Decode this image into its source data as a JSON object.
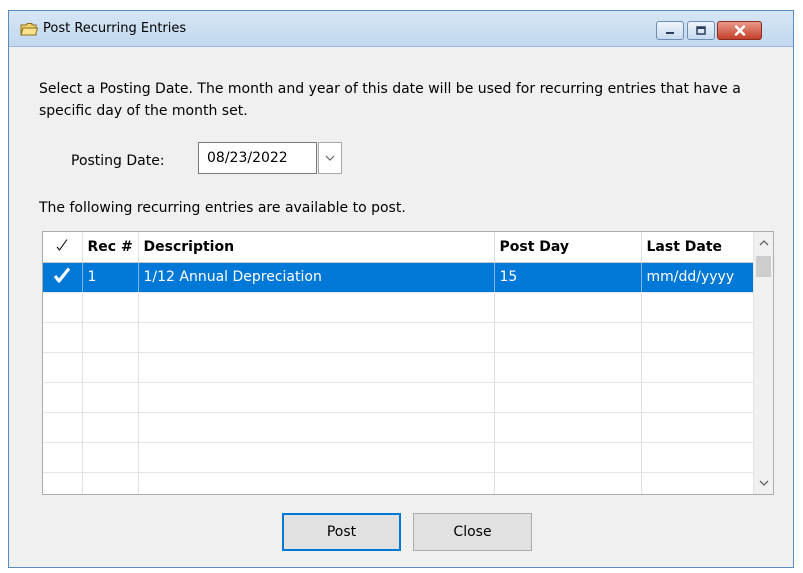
{
  "window": {
    "title": "Post Recurring Entries"
  },
  "instruction": "Select a Posting Date.  The month and year of this date will be used for recurring entries that have a specific day of the month set.",
  "posting_date": {
    "label": "Posting Date:",
    "value": "08/23/2022"
  },
  "list_caption": "The following recurring entries are available to post.",
  "grid": {
    "columns": [
      "✓",
      "Rec #",
      "Description",
      "Post Day",
      "Last Date"
    ],
    "rows": [
      {
        "checked": true,
        "rec": "1",
        "description": "1/12 Annual Depreciation",
        "post_day": "15",
        "last_date": "mm/dd/yyyy",
        "selected": true
      }
    ]
  },
  "buttons": {
    "post": "Post",
    "close": "Close"
  },
  "colors": {
    "selection": "#0078d7",
    "default_button_border": "#0078d7"
  }
}
